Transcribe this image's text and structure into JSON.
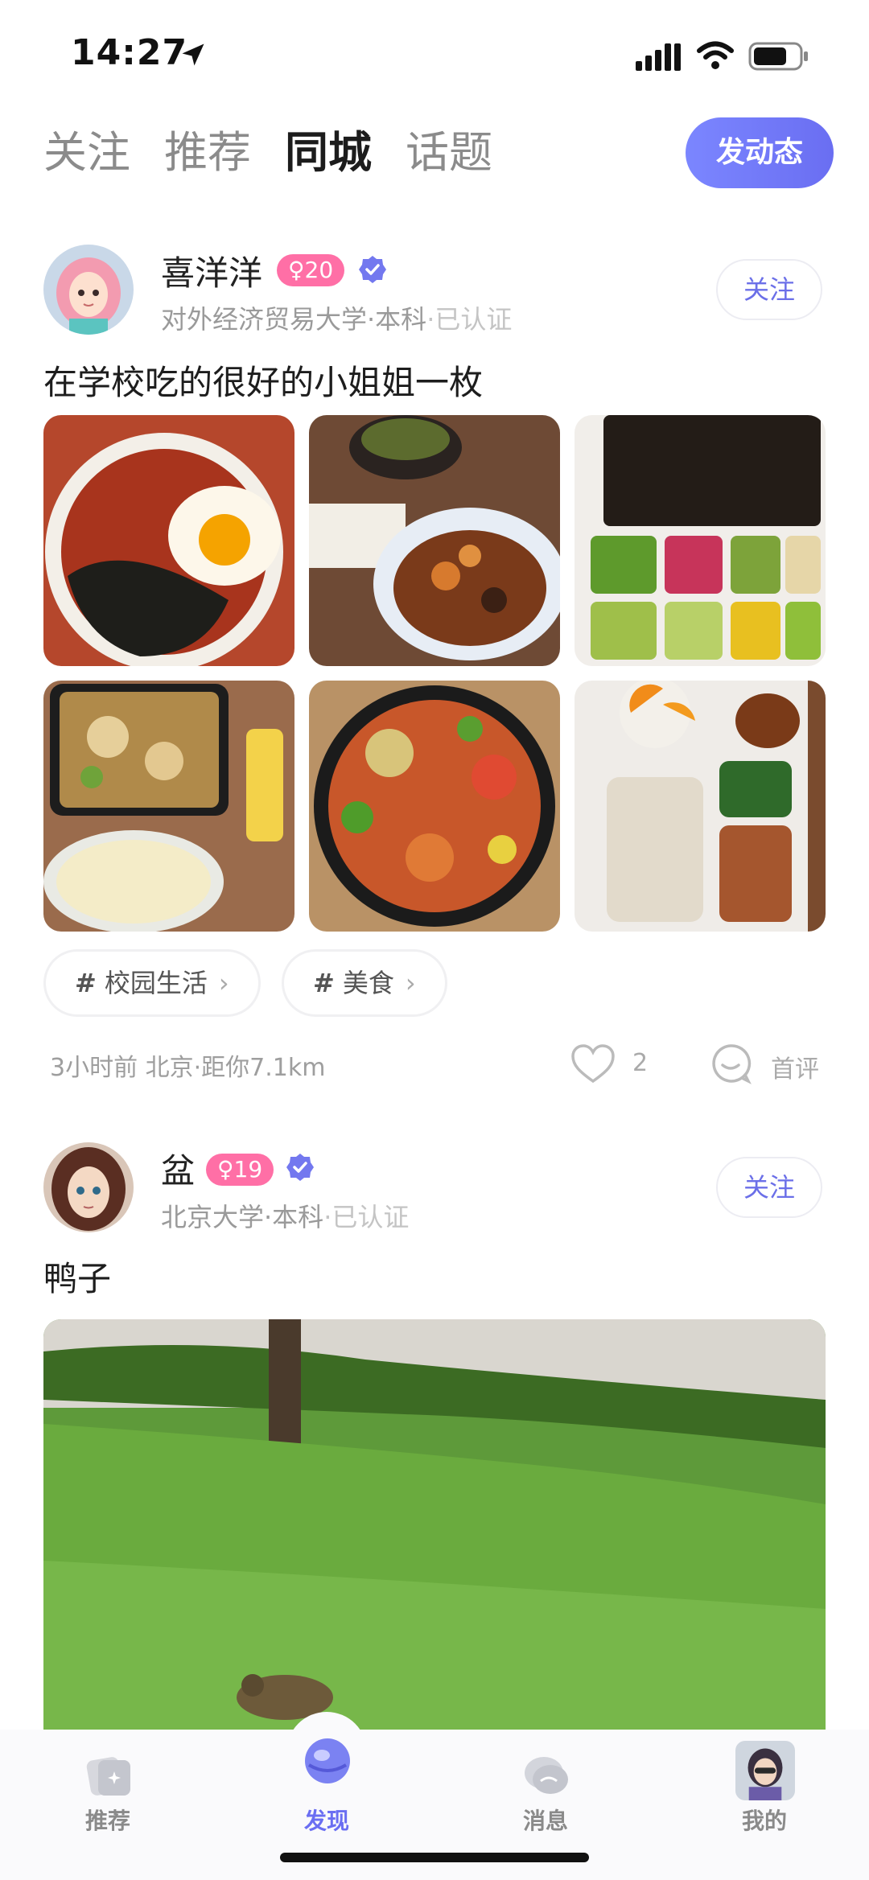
{
  "status_bar": {
    "time": "14:27"
  },
  "top_tabs": [
    {
      "label": "关注",
      "active": false
    },
    {
      "label": "推荐",
      "active": false
    },
    {
      "label": "同城",
      "active": true
    },
    {
      "label": "话题",
      "active": false
    }
  ],
  "post_button": "发动态",
  "posts": [
    {
      "username": "喜洋洋",
      "gender_age": "♀20",
      "school": "对外经济贸易大学·本科",
      "verified": "·已认证",
      "follow": "关注",
      "text": "在学校吃的很好的小姐姐一枚",
      "tags": [
        {
          "hash": "#",
          "label": "校园生活",
          "chev": "›"
        },
        {
          "hash": "#",
          "label": "美食",
          "chev": "›"
        }
      ],
      "meta": "3小时前 北京·距你7.1km",
      "likes": "2",
      "comment_label": "首评"
    },
    {
      "username": "盆",
      "gender_age": "♀19",
      "school": "北京大学·本科",
      "verified": "·已认证",
      "follow": "关注",
      "text": "鸭子"
    }
  ],
  "bottom_nav": [
    {
      "label": "推荐",
      "icon": "cards-icon",
      "active": false
    },
    {
      "label": "发现",
      "icon": "discover-icon",
      "active": true
    },
    {
      "label": "消息",
      "icon": "message-icon",
      "active": false
    },
    {
      "label": "我的",
      "icon": "profile-avatar",
      "active": false
    }
  ],
  "colors": {
    "accent": "#6a6ef2",
    "badge": "#ff6fa6",
    "verify": "#6b6fe8"
  }
}
